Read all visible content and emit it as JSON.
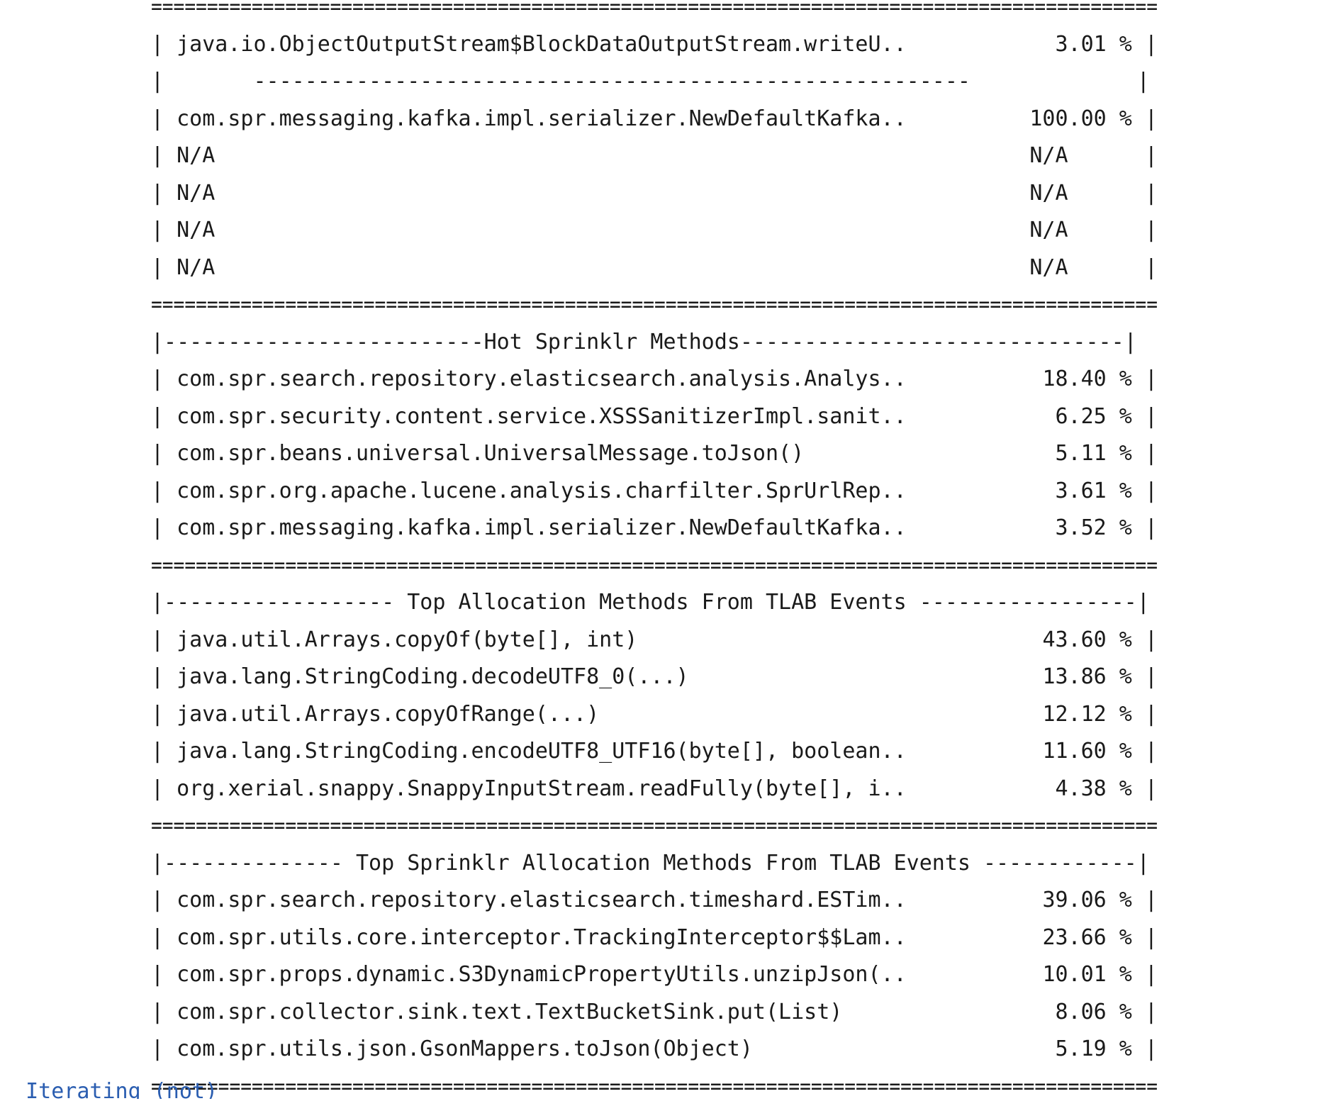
{
  "report": {
    "lines": [
      {
        "kind": "sep",
        "text": "=========================================================================================="
      },
      {
        "kind": "row",
        "text": "| java.io.ObjectOutputStream$BlockDataOutputStream.writeU..",
        "value": "3.01 % |"
      },
      {
        "kind": "center",
        "text": "|       --------------------------------------------------------             |"
      },
      {
        "kind": "row",
        "text": "| com.spr.messaging.kafka.impl.serializer.NewDefaultKafka..",
        "value": "100.00 % |"
      },
      {
        "kind": "row",
        "text": "| N/A",
        "value": "N/A      |"
      },
      {
        "kind": "row",
        "text": "| N/A",
        "value": "N/A      |"
      },
      {
        "kind": "row",
        "text": "| N/A",
        "value": "N/A      |"
      },
      {
        "kind": "row",
        "text": "| N/A",
        "value": "N/A      |"
      },
      {
        "kind": "sep",
        "text": "=========================================================================================="
      },
      {
        "kind": "center",
        "text": "|-------------------------Hot Sprinklr Methods------------------------------|"
      },
      {
        "kind": "row",
        "text": "| com.spr.search.repository.elasticsearch.analysis.Analys..",
        "value": "18.40 % |"
      },
      {
        "kind": "row",
        "text": "| com.spr.security.content.service.XSSSanitizerImpl.sanit..",
        "value": "6.25 % |"
      },
      {
        "kind": "row",
        "text": "| com.spr.beans.universal.UniversalMessage.toJson()",
        "value": "5.11 % |"
      },
      {
        "kind": "row",
        "text": "| com.spr.org.apache.lucene.analysis.charfilter.SprUrlRep..",
        "value": "3.61 % |"
      },
      {
        "kind": "row",
        "text": "| com.spr.messaging.kafka.impl.serializer.NewDefaultKafka..",
        "value": "3.52 % |"
      },
      {
        "kind": "sep",
        "text": "=========================================================================================="
      },
      {
        "kind": "center",
        "text": "|------------------ Top Allocation Methods From TLAB Events -----------------|"
      },
      {
        "kind": "row",
        "text": "| java.util.Arrays.copyOf(byte[], int)",
        "value": "43.60 % |"
      },
      {
        "kind": "row",
        "text": "| java.lang.StringCoding.decodeUTF8_0(...)",
        "value": "13.86 % |"
      },
      {
        "kind": "row",
        "text": "| java.util.Arrays.copyOfRange(...)",
        "value": "12.12 % |"
      },
      {
        "kind": "row",
        "text": "| java.lang.StringCoding.encodeUTF8_UTF16(byte[], boolean..",
        "value": "11.60 % |"
      },
      {
        "kind": "row",
        "text": "| org.xerial.snappy.SnappyInputStream.readFully(byte[], i..",
        "value": "4.38 % |"
      },
      {
        "kind": "sep",
        "text": "=========================================================================================="
      },
      {
        "kind": "center",
        "text": "|-------------- Top Sprinklr Allocation Methods From TLAB Events ------------|"
      },
      {
        "kind": "row",
        "text": "| com.spr.search.repository.elasticsearch.timeshard.ESTim..",
        "value": "39.06 % |"
      },
      {
        "kind": "row",
        "text": "| com.spr.utils.core.interceptor.TrackingInterceptor$$Lam..",
        "value": "23.66 % |"
      },
      {
        "kind": "row",
        "text": "| com.spr.props.dynamic.S3DynamicPropertyUtils.unzipJson(..",
        "value": "10.01 % |"
      },
      {
        "kind": "row",
        "text": "| com.spr.collector.sink.text.TextBucketSink.put(List)",
        "value": "8.06 % |"
      },
      {
        "kind": "row",
        "text": "| com.spr.utils.json.GsonMappers.toJson(Object)",
        "value": "5.19 % |"
      },
      {
        "kind": "sep",
        "text": "=========================================================================================="
      }
    ]
  },
  "tail": "  Iterating (not)"
}
